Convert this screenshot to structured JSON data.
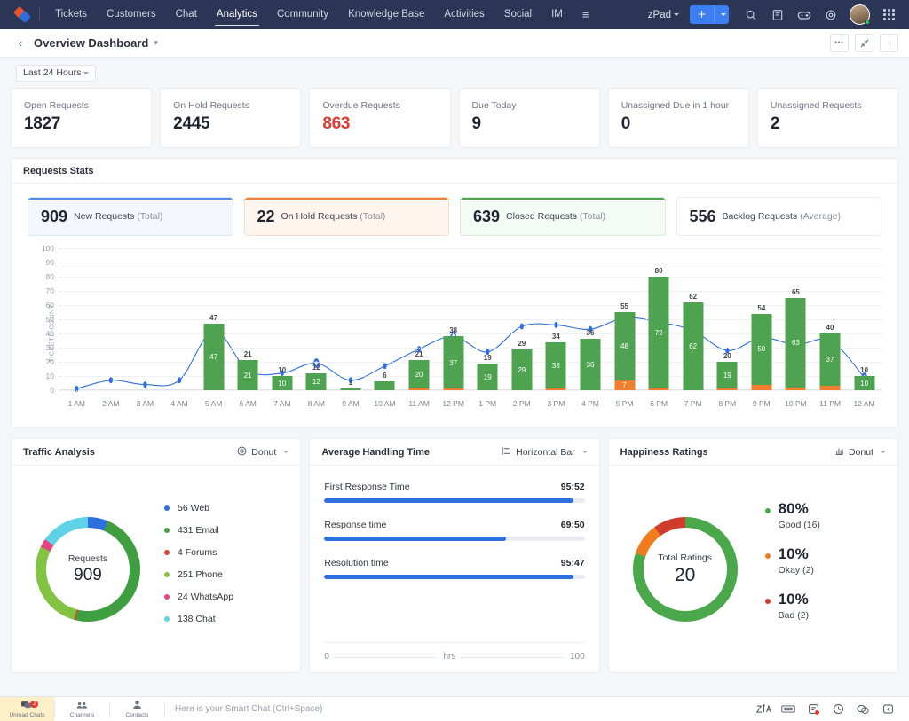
{
  "topnav": {
    "logo_icon": "app-logo-icon",
    "items": [
      {
        "label": "Tickets",
        "active": false
      },
      {
        "label": "Customers",
        "active": false
      },
      {
        "label": "Chat",
        "active": false
      },
      {
        "label": "Analytics",
        "active": true
      },
      {
        "label": "Community",
        "active": false
      },
      {
        "label": "Knowledge Base",
        "active": false
      },
      {
        "label": "Activities",
        "active": false
      },
      {
        "label": "Social",
        "active": false
      },
      {
        "label": "IM",
        "active": false
      }
    ],
    "more_icon": "more-menu-icon",
    "org_label": "zPad",
    "add_label": "+",
    "icons": [
      "search-icon",
      "notes-icon",
      "game-controller-icon",
      "gear-icon"
    ],
    "avatar": "user-avatar",
    "apps_icon": "apps-grid-icon"
  },
  "subheader": {
    "back_icon": "back-arrow-icon",
    "title": "Overview Dashboard",
    "caret_icon": "chevron-down-icon",
    "actions": [
      {
        "name": "more-options-button",
        "glyph": "•••"
      },
      {
        "name": "collapse-button",
        "glyph": "⤡"
      },
      {
        "name": "info-button",
        "glyph": "i"
      }
    ]
  },
  "filter": {
    "range_label": "Last 24 Hours"
  },
  "kpis": [
    {
      "label": "Open Requests",
      "value": "1827",
      "red": false
    },
    {
      "label": "On Hold Requests",
      "value": "2445",
      "red": false
    },
    {
      "label": "Overdue Requests",
      "value": "863",
      "red": true
    },
    {
      "label": "Due Today",
      "value": "9",
      "red": false
    },
    {
      "label": "Unassigned Due in 1 hour",
      "value": "0",
      "red": false
    },
    {
      "label": "Unassigned Requests",
      "value": "2",
      "red": false
    }
  ],
  "requests_stats": {
    "title": "Requests Stats",
    "chips": [
      {
        "num": "909",
        "label": "New Requests",
        "qualifier": "(Total)",
        "tone": "blue"
      },
      {
        "num": "22",
        "label": "On Hold Requests",
        "qualifier": "(Total)",
        "tone": "orange"
      },
      {
        "num": "639",
        "label": "Closed Requests",
        "qualifier": "(Total)",
        "tone": "green"
      },
      {
        "num": "556",
        "label": "Backlog Requests",
        "qualifier": "(Average)",
        "tone": "plain"
      }
    ]
  },
  "chart_data": {
    "type": "bar",
    "title": "Requests Stats",
    "xlabel": "",
    "ylabel": "TICKETS COUNT",
    "ylim": [
      0,
      100
    ],
    "yticks": [
      0,
      10,
      20,
      30,
      40,
      50,
      60,
      70,
      80,
      90,
      100
    ],
    "grid": true,
    "legend": "none",
    "categories": [
      "1 AM",
      "2 AM",
      "3 AM",
      "4 AM",
      "5 AM",
      "6 AM",
      "7 AM",
      "8 AM",
      "9 AM",
      "10 AM",
      "11 AM",
      "12 PM",
      "1 PM",
      "2 PM",
      "3 PM",
      "4 PM",
      "5 PM",
      "6 PM",
      "7 PM",
      "8 PM",
      "9 PM",
      "10 PM",
      "11 PM",
      "12 AM"
    ],
    "series": [
      {
        "name": "Closed Requests",
        "color": "#4fa24f",
        "stack": "bars",
        "values": [
          0,
          0,
          0,
          0,
          47,
          21,
          10,
          12,
          1,
          6,
          20,
          37,
          19,
          29,
          33,
          36,
          48,
          79,
          62,
          19,
          50,
          63,
          37,
          10
        ]
      },
      {
        "name": "On Hold Requests",
        "color": "#ef7f2e",
        "stack": "bars",
        "values": [
          0,
          0,
          0,
          0,
          0,
          0,
          0,
          0,
          0,
          0,
          1,
          1,
          0,
          0,
          1,
          0,
          7,
          1,
          0,
          1,
          4,
          2,
          3,
          0
        ]
      },
      {
        "name": "New Requests",
        "color": "#2f6fe0",
        "type": "line",
        "values": [
          1,
          7,
          4,
          7,
          42,
          14,
          12,
          19,
          7,
          17,
          29,
          38,
          27,
          45,
          46,
          43,
          51,
          48,
          42,
          28,
          37,
          32,
          35,
          9
        ]
      }
    ],
    "bar_totals": [
      null,
      null,
      null,
      null,
      47,
      21,
      10,
      12,
      1,
      6,
      21,
      38,
      19,
      29,
      34,
      36,
      55,
      80,
      62,
      20,
      54,
      65,
      40,
      10
    ],
    "bar_inner_labels": [
      null,
      null,
      null,
      null,
      "47",
      "21",
      "10",
      "12",
      null,
      null,
      "20",
      "37",
      "19",
      "29",
      "33",
      "36",
      "48",
      "79",
      "62",
      "19",
      "50",
      "63",
      "37",
      "10"
    ],
    "bar_inner_orange_labels": [
      null,
      null,
      null,
      null,
      null,
      null,
      null,
      null,
      null,
      null,
      null,
      null,
      null,
      null,
      null,
      null,
      "7",
      null,
      null,
      null,
      null,
      null,
      null,
      null
    ],
    "highlighted_points": [
      "5 AM",
      "6 AM",
      "8 AM",
      "12 PM",
      "6 PM",
      "7 PM",
      "9 PM",
      "10 PM",
      "12 AM"
    ]
  },
  "traffic": {
    "title": "Traffic Analysis",
    "chart_type_label": "Donut",
    "chart_type_icon": "donut-chart-icon",
    "center_label": "Requests",
    "center_value": "909",
    "slices": [
      {
        "label": "Web",
        "value": 56,
        "text": "56 Web",
        "color": "#2f6fe0"
      },
      {
        "label": "Email",
        "value": 431,
        "text": "431 Email",
        "color": "#3f9e3f"
      },
      {
        "label": "Forums",
        "value": 4,
        "text": "4 Forums",
        "color": "#e0402f"
      },
      {
        "label": "Phone",
        "value": 251,
        "text": "251 Phone",
        "color": "#82c341"
      },
      {
        "label": "WhatsApp",
        "value": 24,
        "text": "24 WhatsApp",
        "color": "#e8437e"
      },
      {
        "label": "Chat",
        "value": 138,
        "text": "138 Chat",
        "color": "#5ed3e8"
      }
    ]
  },
  "handling": {
    "title": "Average Handling Time",
    "chart_type_label": "Horizontal Bar",
    "chart_type_icon": "horizontal-bar-icon",
    "rows": [
      {
        "label": "First Response Time",
        "value": "95:52",
        "pct": 95.8
      },
      {
        "label": "Response time",
        "value": "69:50",
        "pct": 69.8
      },
      {
        "label": "Resolution time",
        "value": "95:47",
        "pct": 95.7
      }
    ],
    "axis_min": "0",
    "axis_unit": "hrs",
    "axis_max": "100"
  },
  "happiness": {
    "title": "Happiness Ratings",
    "chart_type_label": "Donut",
    "chart_type_icon": "bar-chart-icon",
    "center_label": "Total Ratings",
    "center_value": "20",
    "items": [
      {
        "pct": "80%",
        "sub": "Good (16)",
        "color": "#4aa84a",
        "value": 80
      },
      {
        "pct": "10%",
        "sub": "Okay (2)",
        "color": "#f07c1e",
        "value": 10
      },
      {
        "pct": "10%",
        "sub": "Bad (2)",
        "color": "#d13b2c",
        "value": 10
      }
    ]
  },
  "bottombar": {
    "unread": {
      "label": "Unread Chats",
      "badge": "2",
      "icon": "chat-bubbles-icon"
    },
    "channels": {
      "label": "Channels",
      "icon": "channels-icon"
    },
    "contacts": {
      "label": "Contacts",
      "icon": "contacts-icon"
    },
    "smartchat_placeholder": "Here is your Smart Chat (Ctrl+Space)",
    "right_icons": [
      "zia-icon",
      "keyboard-icon",
      "notes-alert-icon",
      "clock-icon",
      "chat-icon",
      "reply-icon"
    ]
  }
}
